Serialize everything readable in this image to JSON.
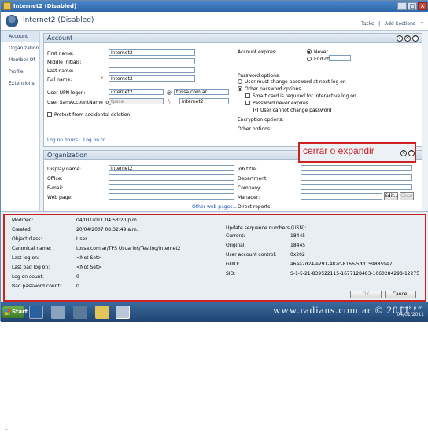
{
  "window": {
    "title": "Internet2 (Disabled)"
  },
  "header": {
    "name": "Internet2 (Disabled)",
    "tasks": "Tasks",
    "add_sections": "Add Sections",
    "tasks_arrow": "|"
  },
  "nav": [
    "Account",
    "Organization",
    "Member Of",
    "Profile",
    "Extensions"
  ],
  "account": {
    "title": "Account",
    "first_name_label": "First name:",
    "first_name": "Internet2",
    "middle_label": "Middle initials:",
    "last_name_label": "Last name:",
    "full_name_label": "Full name:",
    "full_name": "Internet2",
    "upn_label": "User UPN logon:",
    "upn": "internet2",
    "at": "@",
    "domain": "tpssa.com.ar",
    "sam_label": "User SamAccountName logon:",
    "sam_domain": "tpssa",
    "backslash": "\\",
    "sam": "internet2",
    "protect_label": "Protect from accidental deletion",
    "logon_hours": "Log on hours...",
    "logon_to": "Log on to...",
    "expires_label": "Account expires:",
    "never": "Never",
    "end_of": "End of",
    "password_options": "Password options:",
    "must_change": "User must change password at next log on",
    "other_pw": "Other password options",
    "smart_card": "Smart card is required for interactive log on",
    "pw_never_expires": "Password never expires",
    "cannot_change": "User cannot change password",
    "encryption": "Encryption options:",
    "other_options": "Other options:"
  },
  "organization": {
    "title": "Organization",
    "display_label": "Display name:",
    "display": "Internet2",
    "office_label": "Office:",
    "email_label": "E-mail:",
    "web_label": "Web page:",
    "other_web": "Other web pages...",
    "job_label": "Job title:",
    "dept_label": "Department:",
    "company_label": "Company:",
    "manager_label": "Manager:",
    "edit": "Edit...",
    "clear": "Clear",
    "direct_label": "Direct reports:"
  },
  "annotation": {
    "text": "cerrar o expandir"
  },
  "details": {
    "left": [
      [
        "Modified:",
        "04/01/2011 04:53:20 p.m."
      ],
      [
        "Created:",
        "20/04/2007 08:32:49 a.m."
      ],
      [
        "Object class:",
        "User"
      ],
      [
        "Canonical name:",
        "tpssa.com.ar/TPS Usuarios/Testing/Internet2"
      ],
      [
        "Last log on:",
        "<Not Set>"
      ],
      [
        "Last bad log on:",
        "<Not Set>"
      ],
      [
        "Log on count:",
        "0"
      ],
      [
        "Bad password count:",
        "0"
      ]
    ],
    "usn_title": "Update sequence numbers (USN):",
    "right": [
      [
        "Current:",
        "18445"
      ],
      [
        "Original:",
        "18445"
      ],
      [
        "User account control:",
        "0x202"
      ],
      [
        "GUID:",
        "a6aa2d24-e291-482c-8166-5dd1598859e7"
      ],
      [
        "SID:",
        "S-1-5-21-839522115-1677128483-1060284298-12275"
      ]
    ],
    "ok": "OK",
    "cancel": "Cancel"
  },
  "taskbar": {
    "start": "Start",
    "watermark": "www.radians.com.ar © 2011",
    "time": "5:18 p.m.",
    "date": "04/01/2011"
  },
  "colors": {
    "annotation": "#cc2222",
    "title_bar": "#2f67a8",
    "link": "#1a55b5"
  }
}
